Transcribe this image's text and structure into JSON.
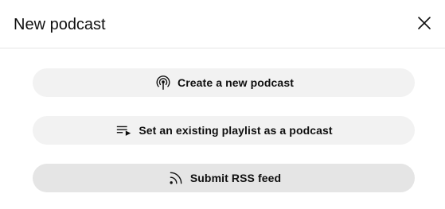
{
  "dialog": {
    "title": "New podcast",
    "close_icon": "close-icon"
  },
  "options": [
    {
      "label": "Create a new podcast",
      "icon": "podcast-icon"
    },
    {
      "label": "Set an existing playlist as a podcast",
      "icon": "playlist-add-icon"
    },
    {
      "label": "Submit RSS feed",
      "icon": "rss-feed-icon"
    }
  ],
  "colors": {
    "button_bg": "#f2f2f2",
    "button_hover_bg": "#e5e5e5",
    "text": "#0f0f0f",
    "divider": "#e5e5e5"
  }
}
